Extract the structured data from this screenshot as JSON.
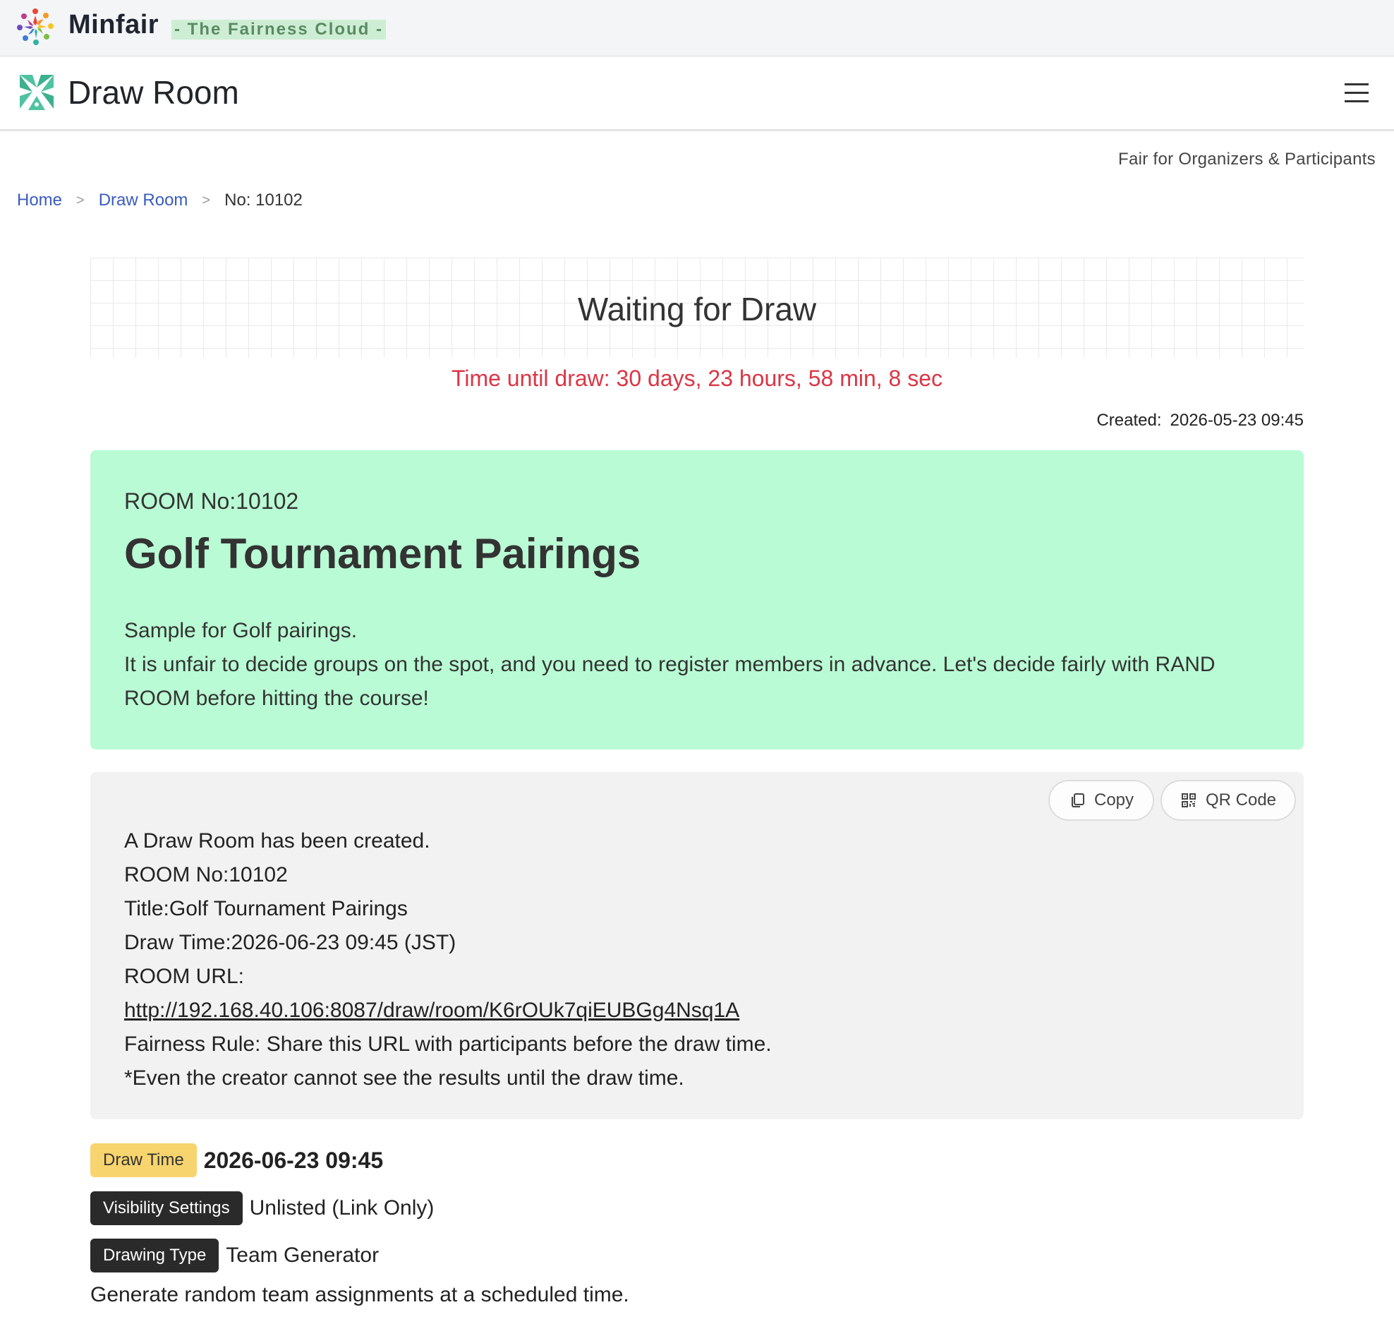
{
  "brand": {
    "name": "Minfair",
    "tagline": "- The Fairness Cloud -"
  },
  "navbar": {
    "title": "Draw Room"
  },
  "subtitle": "Fair for Organizers & Participants",
  "breadcrumb": {
    "home": "Home",
    "section": "Draw Room",
    "current": "No: 10102"
  },
  "status": {
    "heading": "Waiting for Draw",
    "countdown": "Time until draw: 30 days, 23 hours, 58 min, 8 sec",
    "created_label": "Created:",
    "created_value": "2026-05-23 09:45"
  },
  "room": {
    "number": "ROOM No:10102",
    "title": "Golf Tournament Pairings",
    "description_line1": "Sample for Golf pairings.",
    "description_line2": "It is unfair to decide groups on the spot, and you need to register members in advance. Let's decide fairly with RAND ROOM before hitting the course!"
  },
  "share": {
    "copy_label": "Copy",
    "qr_label": "QR Code",
    "line1": "A Draw Room has been created.",
    "line2": "ROOM No:10102",
    "line3": "Title:Golf Tournament Pairings",
    "line4": "Draw Time:2026-06-23 09:45 (JST)",
    "line5": "ROOM URL:",
    "url": "http://192.168.40.106:8087/draw/room/K6rOUk7qiEUBGg4Nsq1A",
    "line7": "Fairness Rule: Share this URL with participants before the draw time.",
    "line8": "*Even the creator cannot see the results until the draw time."
  },
  "info": {
    "draw_time_label": "Draw Time",
    "draw_time_value": "2026-06-23 09:45",
    "visibility_label": "Visibility Settings",
    "visibility_value": "Unlisted (Link Only)",
    "type_label": "Drawing Type",
    "type_value": "Team Generator",
    "type_description": "Generate random team assignments at a scheduled time."
  },
  "colors": {
    "accent_green": "#b9fbd4",
    "countdown_red": "#dc3545",
    "link_blue": "#3a5bbf",
    "badge_yellow": "#f8d46e",
    "badge_dark": "#2a2a2a"
  },
  "icons": [
    "minfair-logo-icon",
    "draw-room-logo-icon",
    "menu-icon",
    "copy-icon",
    "qr-code-icon"
  ]
}
